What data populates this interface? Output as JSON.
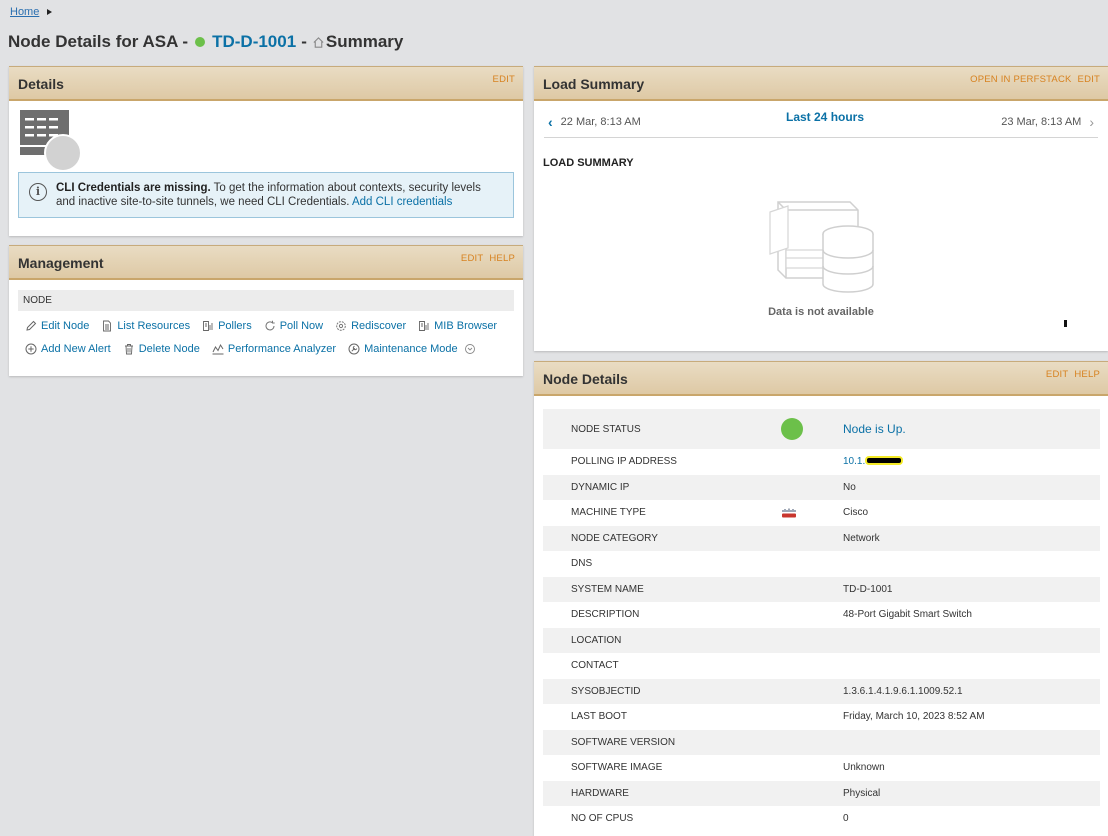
{
  "breadcrumb": {
    "home": "Home"
  },
  "title": {
    "prefix": "Node Details for ASA -",
    "node": "TD-D-1001",
    "separator": "-",
    "view": "Summary"
  },
  "details_panel": {
    "title": "Details",
    "action_edit": "EDIT",
    "alert_bold": "CLI Credentials are missing.",
    "alert_text": " To get the information about contexts, security levels and inactive site-to-site tunnels, we need CLI Credentials. ",
    "alert_link": "Add CLI credentials"
  },
  "management_panel": {
    "title": "Management",
    "action_edit": "EDIT",
    "action_help": "HELP",
    "section": "NODE",
    "row1": [
      "Edit Node",
      "List Resources",
      "Pollers",
      "Poll Now",
      "Rediscover",
      "MIB Browser"
    ],
    "row2": [
      "Add New Alert",
      "Delete Node",
      "Performance Analyzer",
      "Maintenance Mode"
    ]
  },
  "load_panel": {
    "title": "Load Summary",
    "action_perfstack": "OPEN IN PERFSTACK",
    "action_edit": "EDIT",
    "range_start": "22 Mar, 8:13 AM",
    "range_label": "Last 24 hours",
    "range_end": "23 Mar, 8:13 AM",
    "chart_title": "LOAD SUMMARY",
    "no_data": "Data is not available"
  },
  "node_details_panel": {
    "title": "Node Details",
    "action_edit": "EDIT",
    "action_help": "HELP",
    "rows": [
      {
        "key": "NODE STATUS",
        "value": "Node is Up."
      },
      {
        "key": "POLLING IP ADDRESS",
        "value": "10.1."
      },
      {
        "key": "DYNAMIC IP",
        "value": "No"
      },
      {
        "key": "MACHINE TYPE",
        "value": "Cisco"
      },
      {
        "key": "NODE CATEGORY",
        "value": "Network"
      },
      {
        "key": "DNS",
        "value": ""
      },
      {
        "key": "SYSTEM NAME",
        "value": "TD-D-1001"
      },
      {
        "key": "DESCRIPTION",
        "value": "48-Port Gigabit Smart Switch"
      },
      {
        "key": "LOCATION",
        "value": ""
      },
      {
        "key": "CONTACT",
        "value": ""
      },
      {
        "key": "SYSOBJECTID",
        "value": "1.3.6.1.4.1.9.6.1.1009.52.1"
      },
      {
        "key": "LAST BOOT",
        "value": "Friday, March 10, 2023 8:52 AM"
      },
      {
        "key": "SOFTWARE VERSION",
        "value": ""
      },
      {
        "key": "SOFTWARE IMAGE",
        "value": "Unknown"
      },
      {
        "key": "HARDWARE",
        "value": "Physical"
      },
      {
        "key": "NO OF CPUS",
        "value": "0"
      }
    ]
  },
  "colors": {
    "status_up": "#6cc04a",
    "link": "#0b71a6",
    "action": "#d78220"
  }
}
